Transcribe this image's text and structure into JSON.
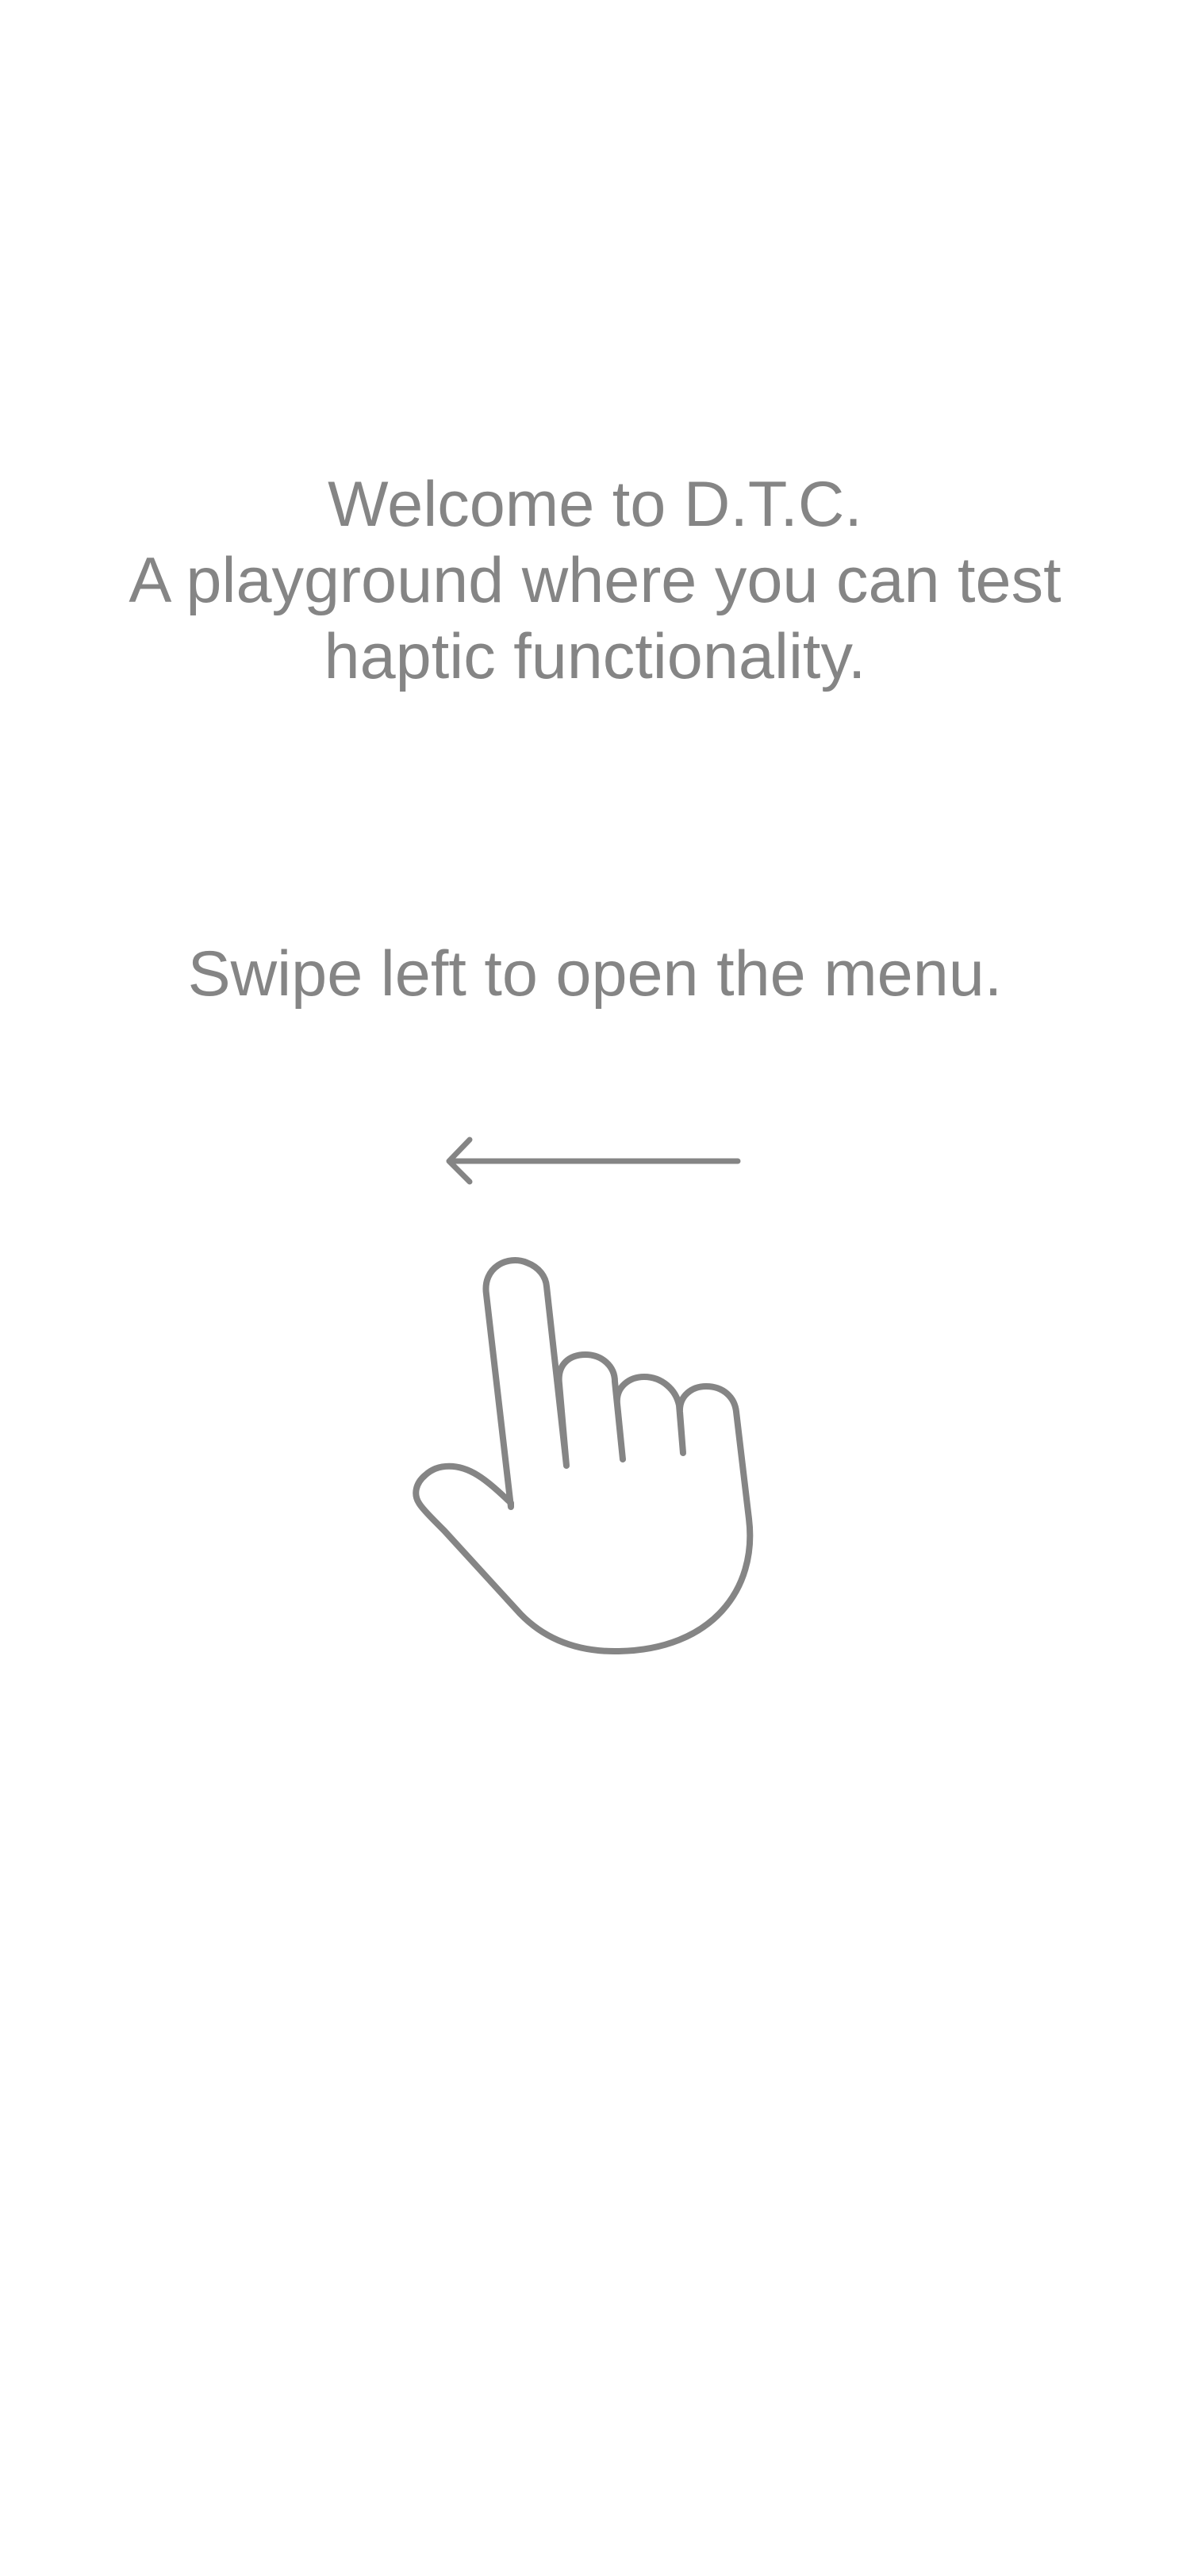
{
  "welcome": {
    "line1": "Welcome to D.T.C.",
    "line2": "A playground where you can test",
    "line3": "haptic functionality."
  },
  "instruction": {
    "text": "Swipe left to open the menu."
  },
  "icons": {
    "arrow": "arrow-left-icon",
    "hand": "pointing-hand-icon"
  },
  "colors": {
    "background": "#ffffff",
    "text": "#858585",
    "icon_stroke": "#858585"
  }
}
